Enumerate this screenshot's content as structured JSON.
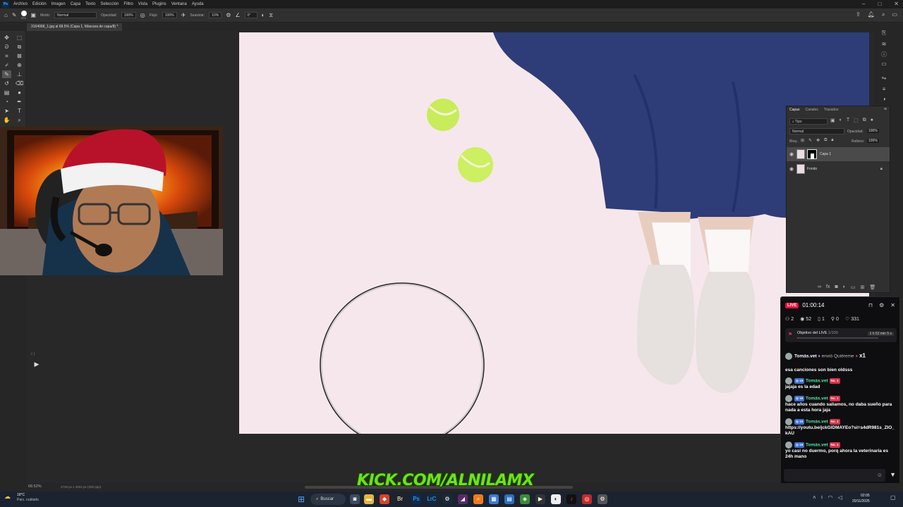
{
  "app": {
    "logo": "Ps",
    "menu": [
      "Archivo",
      "Edición",
      "Imagen",
      "Capa",
      "Texto",
      "Selección",
      "Filtro",
      "Vista",
      "Plugins",
      "Ventana",
      "Ayuda"
    ]
  },
  "options": {
    "brush_size": "572",
    "mode_label": "Modo:",
    "mode_value": "Normal",
    "opacity_label": "Opacidad:",
    "opacity_value": "100%",
    "flow_label": "Flujo:",
    "flow_value": "100%",
    "smoothing_label": "Suavizar:",
    "smoothing_value": "10%",
    "angle_value": "0°"
  },
  "document": {
    "tab_title": "3164068_1.jpg al 68.5% (Capa 1, Máscara de capa/8) *",
    "zoom": "68.52%",
    "dimensions": "2728 px x 4604 px (300 ppp)"
  },
  "layers_panel": {
    "tabs": [
      "Capas",
      "Canales",
      "Trazados"
    ],
    "filter_kind": "Tipo",
    "blend_mode": "Normal",
    "opacity_label": "Opacidad:",
    "opacity_value": "100%",
    "lock_label": "Bloq.:",
    "fill_label": "Relleno:",
    "fill_value": "100%",
    "layers": [
      {
        "name": "Capa 1",
        "has_mask": true,
        "selected": true
      },
      {
        "name": "Fondo",
        "locked": true
      }
    ]
  },
  "chat": {
    "live_label": "LIVE",
    "duration": "01:00:14",
    "stats": {
      "viewers": "2",
      "views": "52",
      "subs": "1",
      "gifts": "0",
      "likes": "331"
    },
    "goal_label": "Objetivo del LIVE",
    "goal_progress": "1/100",
    "goal_time": "1 h 52 min 5 s",
    "gift_message": {
      "user": "Tomás.vet",
      "action": "envió Quiéreme",
      "count": "x1"
    },
    "messages": [
      {
        "text": "esa canciones son bien oldsss",
        "user": "",
        "level": "",
        "rank": ""
      },
      {
        "user": "Tomás.vet",
        "level": "15",
        "rank": "No. 1",
        "text": "jajaja es la edad"
      },
      {
        "user": "Tomás.vet",
        "level": "15",
        "rank": "No. 1",
        "text": "hace años cuando saliamos, no daba sueño para nada a esta hora jaja"
      },
      {
        "user": "Tomás.vet",
        "level": "15",
        "rank": "No. 1",
        "text": "https://youtu.be/jckGIDMAYEo?si=s4dR981s_ZIO_kAU"
      },
      {
        "user": "Tomás.vet",
        "level": "15",
        "rank": "No. 1",
        "text": "yo casi no duermo, porq ahora la veterinaria es 24h mano"
      }
    ]
  },
  "overlay": {
    "kick_url": "KICK.COM/ALNILAMX"
  },
  "taskbar": {
    "weather_temp": "18°C",
    "weather_desc": "Parc. nublado",
    "search_label": "Buscar",
    "time": "02:05",
    "date": "20/11/2025"
  },
  "colors": {
    "accent_green": "#6fe21a",
    "live_red": "#e9113c",
    "chat_user": "#53e3a6"
  }
}
